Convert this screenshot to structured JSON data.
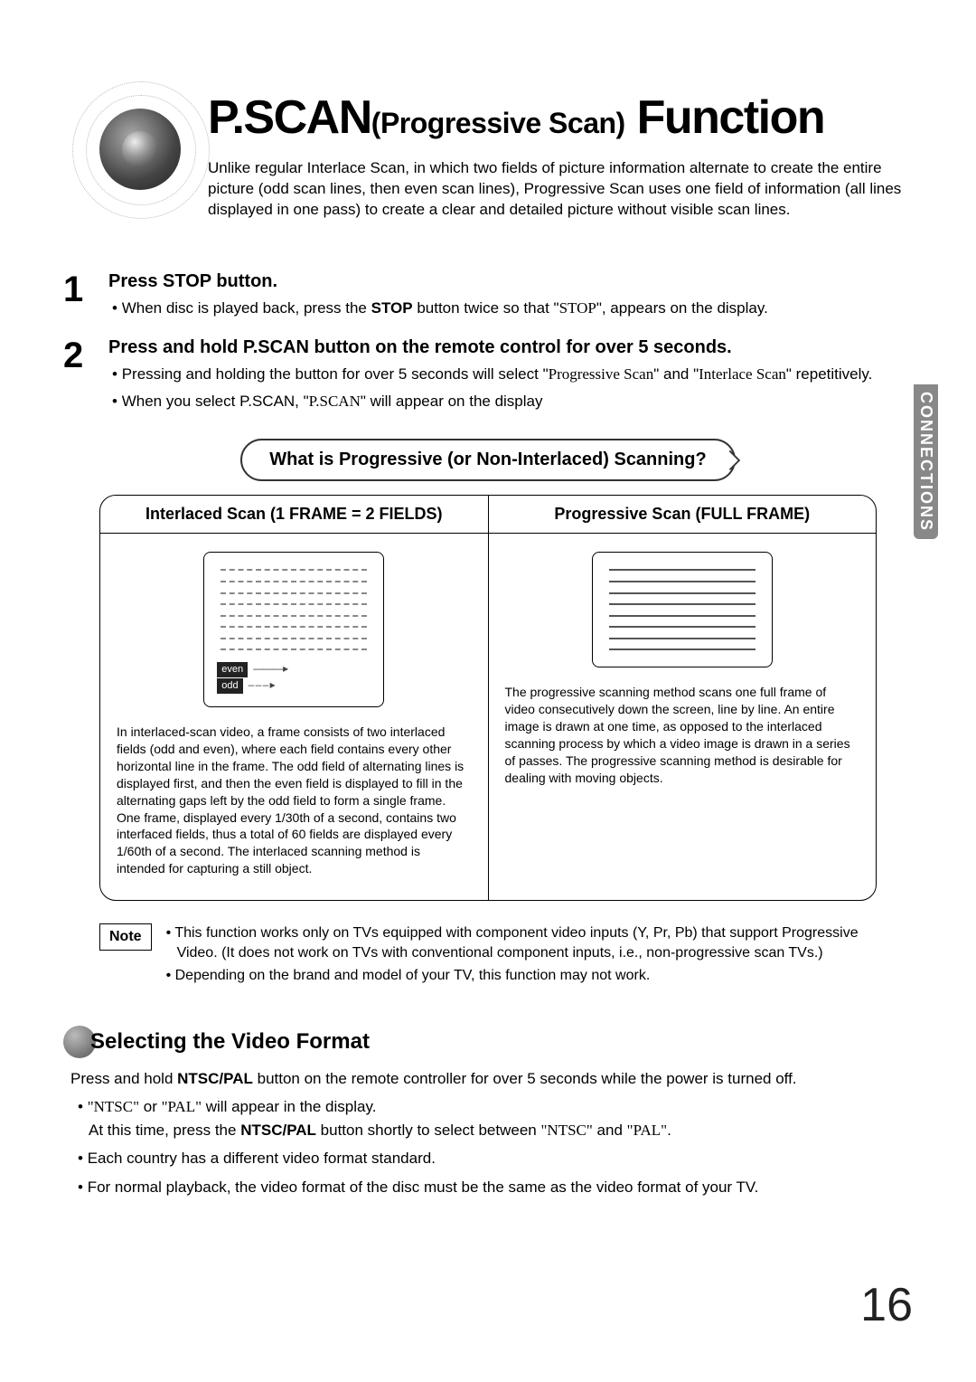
{
  "sideTab": "CONNECTIONS",
  "pageNumber": "16",
  "title": {
    "pscan": "P.SCAN",
    "paren": "(Progressive Scan)",
    "func": " Function"
  },
  "intro": "Unlike regular Interlace Scan, in which two fields of picture information alternate to create the entire picture (odd scan lines, then even scan lines), Progressive Scan uses one field of information (all lines displayed in one pass) to create a clear and detailed picture without visible scan lines.",
  "steps": [
    {
      "num": "1",
      "head": "Press STOP button.",
      "subs": [
        {
          "pre": "When disc is played back, press the ",
          "bold": "STOP",
          "mid": " button twice so that \"",
          "serif": "STOP",
          "post": "\", appears on the display."
        }
      ]
    },
    {
      "num": "2",
      "head": "Press and hold P.SCAN button on the remote control for over 5 seconds.",
      "subs": [
        {
          "pre": "Pressing and holding the button for over 5 seconds will select \"",
          "serif": "Progressive Scan",
          "mid2": "\" and \"",
          "serif2": "Interlace Scan",
          "post": "\" repetitively."
        },
        {
          "pre": "When you select P.SCAN, \"",
          "serif": "P.SCAN",
          "post": "\" will appear on the display"
        }
      ]
    }
  ],
  "scanSection": {
    "pillTitle": "What is Progressive (or Non-Interlaced) Scanning?",
    "leftHeader": "Interlaced Scan (1 FRAME = 2 FIELDS)",
    "rightHeader": "Progressive Scan (FULL FRAME)",
    "leftLabels": {
      "even": "even",
      "odd": "odd"
    },
    "leftText": "In interlaced-scan video, a frame consists of two interlaced fields (odd and even), where each field contains every other horizontal line in the frame. The odd field of alternating lines is displayed first, and then the even field is displayed to fill in the alternating gaps left by the odd field to form a single frame. One frame, displayed every 1/30th of a second, contains two interfaced fields, thus a total of 60 fields are displayed every 1/60th of a second. The interlaced scanning method is intended for capturing a still object.",
    "rightText": "The progressive scanning method scans one full frame of video consecutively down the screen, line by line. An entire image is drawn at one time, as opposed to the interlaced scanning process by which a video image is drawn in a series of passes. The progressive scanning method is desirable for dealing with moving objects."
  },
  "note": {
    "label": "Note",
    "items": [
      "This function works only on TVs equipped with component video inputs (Y, Pr, Pb) that support Progressive Video. (It does not work on TVs with conventional component inputs, i.e., non-progressive scan TVs.)",
      "Depending on the brand and model of your TV, this function may not work."
    ]
  },
  "videoFormat": {
    "heading": "Selecting the Video Format",
    "lead": {
      "pre": "Press and hold ",
      "bold": "NTSC/PAL",
      "post": " button on the remote controller for over 5 seconds while the power is turned off."
    },
    "bullets": [
      {
        "serif1": "\"NTSC\"",
        "t1": " or ",
        "serif2": "\"PAL\"",
        "t2": " will appear in the display.",
        "line2pre": "At this time, press the ",
        "line2bold": "NTSC/PAL",
        "line2mid": " button shortly to select between ",
        "line2serif1": "\"NTSC\"",
        "line2and": " and ",
        "line2serif2": "\"PAL\"",
        "line2end": "."
      },
      {
        "plain": "Each country has a different video format standard."
      },
      {
        "plain": "For normal playback, the video format of the disc must be the same as the video format of your TV."
      }
    ]
  }
}
